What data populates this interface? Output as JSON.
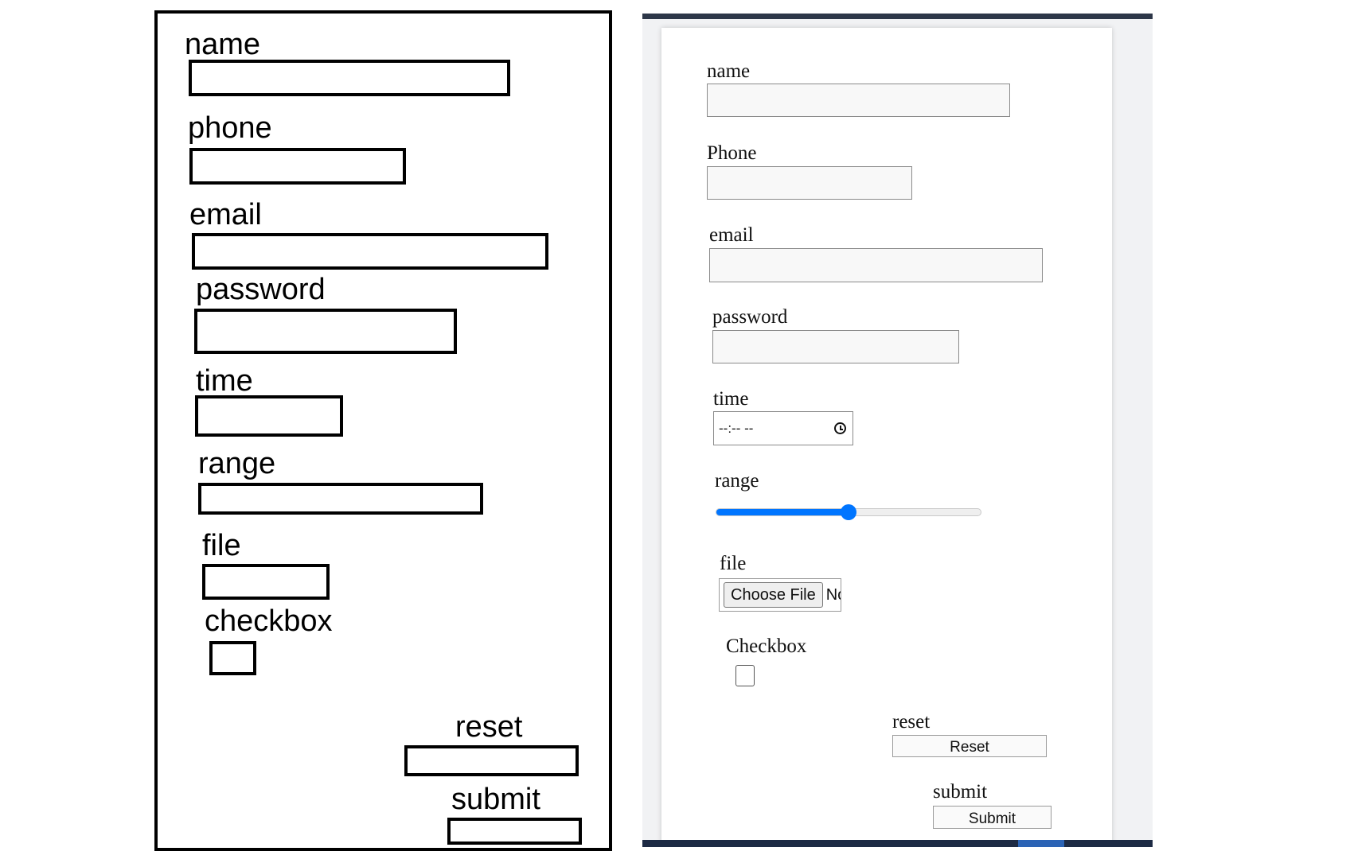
{
  "wireframe": {
    "labels": {
      "name": "name",
      "phone": "phone",
      "email": "email",
      "password": "password",
      "time": "time",
      "range": "range",
      "file": "file",
      "checkbox": "checkbox",
      "reset": "reset",
      "submit": "submit"
    }
  },
  "form": {
    "labels": {
      "name": "name",
      "phone": "Phone",
      "email": "email",
      "password": "password",
      "time": "time",
      "range": "range",
      "file": "file",
      "checkbox": "Checkbox",
      "reset": "reset",
      "submit": "submit"
    },
    "time_value": "--:-- --",
    "range_value_fraction": 0.5,
    "file_button": "Choose File",
    "file_status": "No",
    "reset_button": "Reset",
    "submit_button": "Submit",
    "accent_color": "#0075ff"
  }
}
